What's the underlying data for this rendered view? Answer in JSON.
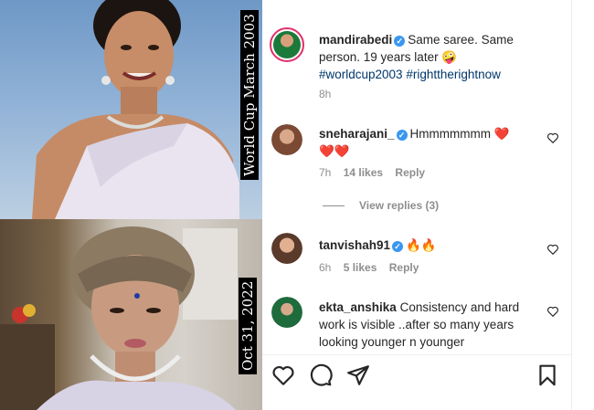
{
  "media": {
    "top_caption": "World Cup March 2003",
    "bottom_caption": "Oct 31, 2022"
  },
  "post": {
    "username": "mandirabedi",
    "caption": "Same saree. Same person. 19 years later",
    "caption_emoji": "🤪",
    "hashtag1": "#worldcup2003",
    "hashtag2": "#righttherightnow",
    "time": "8h"
  },
  "comments": [
    {
      "username": "sneharajani_",
      "text": "Hmmmmmmm",
      "emoji_after": "❤️",
      "emoji_line2": "❤️❤️",
      "time": "7h",
      "likes": "14 likes",
      "reply": "Reply",
      "view_replies": "View replies (3)"
    },
    {
      "username": "tanvishah91",
      "text": "",
      "emoji_after": "🔥🔥",
      "time": "6h",
      "likes": "5 likes",
      "reply": "Reply"
    },
    {
      "username": "ekta_anshika",
      "text": "Consistency and hard work is visible ..after so many years looking younger n younger"
    }
  ],
  "icons": {
    "verified": "verified-badge-icon",
    "heart": "heart-icon",
    "comment": "comment-icon",
    "share": "share-icon",
    "save": "bookmark-icon"
  },
  "colors": {
    "link": "#00376b",
    "verified": "#3897f0",
    "muted": "#8e8e8e",
    "story_ring": "#e1306c"
  }
}
